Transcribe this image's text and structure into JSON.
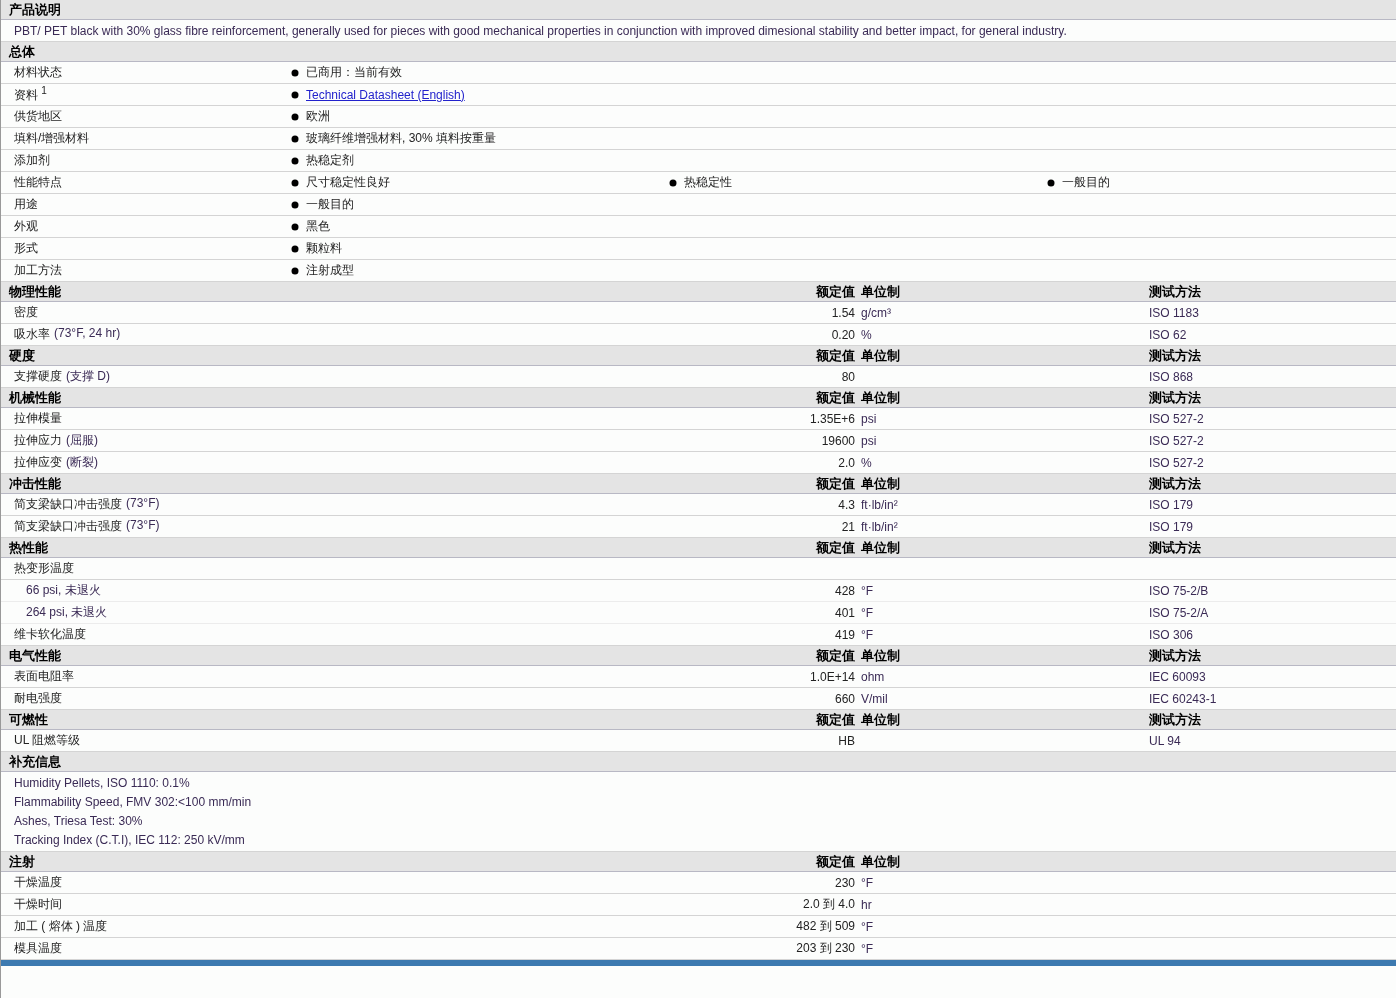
{
  "sections": [
    {
      "kind": "description",
      "title": "产品说明",
      "text": "PBT/ PET black with 30% glass fibre reinforcement, generally used for pieces with good mechanical properties in conjunction with improved dimesional stability and better impact, for general industry."
    },
    {
      "kind": "general",
      "title": "总体",
      "rows": [
        {
          "label": "材料状态",
          "values": [
            {
              "kind": "text",
              "text": "已商用：当前有效"
            }
          ]
        },
        {
          "label": "资料 $^{1}$",
          "values": [
            {
              "kind": "link",
              "text": "Technical Datasheet (English)"
            }
          ]
        },
        {
          "label": "供货地区",
          "values": [
            {
              "kind": "text",
              "text": "欧洲"
            }
          ]
        },
        {
          "label": "填料/增强材料",
          "values": [
            {
              "kind": "text",
              "text": "玻璃纤维增强材料, 30% 填料按重量"
            }
          ]
        },
        {
          "label": "添加剂",
          "values": [
            {
              "kind": "text",
              "text": "热稳定剂"
            }
          ]
        },
        {
          "label": "性能特点",
          "values": [
            {
              "kind": "text",
              "text": "尺寸稳定性良好"
            },
            {
              "kind": "text",
              "text": "热稳定性"
            },
            {
              "kind": "text",
              "text": "一般目的"
            }
          ]
        },
        {
          "label": "用途",
          "values": [
            {
              "kind": "text",
              "text": "一般目的"
            }
          ]
        },
        {
          "label": "外观",
          "values": [
            {
              "kind": "text",
              "text": "黑色"
            }
          ]
        },
        {
          "label": "形式",
          "values": [
            {
              "kind": "text",
              "text": "颗粒料"
            }
          ]
        },
        {
          "label": "加工方法",
          "values": [
            {
              "kind": "text",
              "text": "注射成型"
            }
          ]
        }
      ]
    },
    {
      "kind": "properties",
      "title": "物理性能",
      "value_header": "额定值",
      "unit_header": "单位制",
      "method_header": "测试方法",
      "rows": [
        {
          "label": "密度",
          "value": "1.54",
          "unit": "g/cm³",
          "method": "ISO 1183"
        },
        {
          "label": "吸水率",
          "condition": "(73°F, 24 hr)",
          "value": "0.20",
          "unit": "%",
          "method": "ISO 62"
        }
      ]
    },
    {
      "kind": "properties",
      "title": "硬度",
      "value_header": "额定值",
      "unit_header": "单位制",
      "method_header": "测试方法",
      "rows": [
        {
          "label": "支撑硬度",
          "condition": "(支撑  D)",
          "value": "80",
          "method": "ISO 868"
        }
      ]
    },
    {
      "kind": "properties",
      "title": "机械性能",
      "value_header": "额定值",
      "unit_header": "单位制",
      "method_header": "测试方法",
      "rows": [
        {
          "label": "拉伸模量",
          "value": "1.35E+6",
          "unit": "psi",
          "method": "ISO 527-2"
        },
        {
          "label": "拉伸应力",
          "condition": "(屈服)",
          "value": "19600",
          "unit": "psi",
          "method": "ISO 527-2"
        },
        {
          "label": "拉伸应变",
          "condition": "(断裂)",
          "value": "2.0",
          "unit": "%",
          "method": "ISO 527-2"
        }
      ]
    },
    {
      "kind": "properties",
      "title": "冲击性能",
      "value_header": "额定值",
      "unit_header": "单位制",
      "method_header": "测试方法",
      "rows": [
        {
          "label": "简支梁缺口冲击强度",
          "condition": "(73°F)",
          "value": "4.3",
          "unit": "ft·lb/in²",
          "method": "ISO 179"
        },
        {
          "label": "简支梁缺口冲击强度",
          "condition": "(73°F)",
          "value": "21",
          "unit": "ft·lb/in²",
          "method": "ISO 179"
        }
      ]
    },
    {
      "kind": "properties",
      "title": "热性能",
      "value_header": "额定值",
      "unit_header": "单位制",
      "method_header": "测试方法",
      "rows": [
        {
          "label": "热变形温度",
          "children": [
            {
              "label": "66 psi, 未退火",
              "value": "428",
              "unit": "°F",
              "method": "ISO 75-2/B"
            },
            {
              "label": "264 psi, 未退火",
              "value": "401",
              "unit": "°F",
              "method": "ISO 75-2/A"
            }
          ]
        },
        {
          "label": "维卡软化温度",
          "value": "419",
          "unit": "°F",
          "method": "ISO 306"
        }
      ]
    },
    {
      "kind": "properties",
      "title": "电气性能",
      "value_header": "额定值",
      "unit_header": "单位制",
      "method_header": "测试方法",
      "rows": [
        {
          "label": "表面电阻率",
          "value": "1.0E+14",
          "unit": "ohm",
          "method": "IEC 60093"
        },
        {
          "label": "耐电强度",
          "value": "660",
          "unit": "V/mil",
          "method": "IEC 60243-1"
        }
      ]
    },
    {
      "kind": "properties",
      "title": "可燃性",
      "value_header": "额定值",
      "unit_header": "单位制",
      "method_header": "测试方法",
      "rows": [
        {
          "label": "UL 阻燃等级",
          "value": "HB",
          "method": "UL 94"
        }
      ]
    },
    {
      "kind": "notes",
      "title": "补充信息",
      "lines": [
        "Humidity Pellets, ISO 1110: 0.1%",
        "Flammability Speed, FMV 302:<100 mm/min",
        "Ashes, Triesa Test: 30%",
        "Tracking Index (C.T.I), IEC 112: 250 kV/mm"
      ]
    },
    {
      "kind": "properties",
      "title": "注射",
      "value_header": "额定值",
      "unit_header": "单位制",
      "rows": [
        {
          "label": "干燥温度",
          "value": "230",
          "unit": "°F"
        },
        {
          "label": "干燥时间",
          "value": "2.0 到  4.0",
          "unit": "hr"
        },
        {
          "label": "加工 ( 熔体 ) 温度",
          "value": "482 到  509",
          "unit": "°F"
        },
        {
          "label": "模具温度",
          "value": "203 到  230",
          "unit": "°F"
        }
      ]
    }
  ]
}
